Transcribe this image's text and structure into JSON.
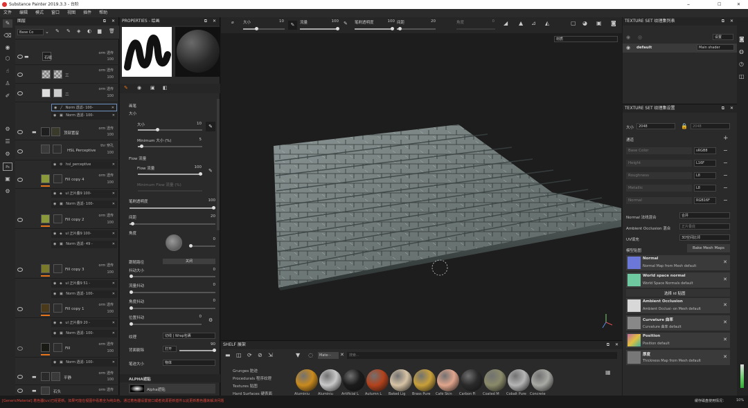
{
  "titlebar": {
    "title": "Substance Painter 2019.3.3 - 台阶",
    "min": "–",
    "max": "☐",
    "close": "✕"
  },
  "menu": [
    "文件",
    "编辑",
    "模式",
    "窗口",
    "视图",
    "插件",
    "帮助"
  ],
  "layers_panel": {
    "title": "图层",
    "blend_mode": "Base Co",
    "layers": [
      {
        "name": "石缝",
        "blend": "orm 透传",
        "opacity": "100"
      },
      {
        "name": "三",
        "blend": "orm 透传",
        "opacity": "100"
      },
      {
        "name": "二",
        "blend": "orm 透传",
        "opacity": "100"
      },
      {
        "name": "顶部置留",
        "blend": "orm 透传",
        "opacity": "100"
      },
      {
        "name": "HSL Perceptive",
        "blend": "thr 穿孔",
        "opacity": "100"
      },
      {
        "name": "Fill copy 4",
        "blend": "orm 透传",
        "opacity": "100"
      },
      {
        "name": "Fill copy 2",
        "blend": "orm 透传",
        "opacity": "100"
      },
      {
        "name": "Fill copy 3",
        "blend": "orm 透传",
        "opacity": "100"
      },
      {
        "name": "Fill copy 1",
        "blend": "orm 透传",
        "opacity": "100"
      },
      {
        "name": "Fill",
        "blend": "orm 透传",
        "opacity": "100"
      },
      {
        "name": "平静",
        "blend": "orm 透传",
        "opacity": "100"
      },
      {
        "name": "石头",
        "blend": "orm 透传",
        "opacity": "100"
      }
    ],
    "subrows": [
      {
        "text": "Norm 透滤- 100-"
      },
      {
        "text": "Norm 透滤- 100-"
      },
      {
        "text": "hsl_perceptive"
      },
      {
        "text": "ul 正片叠9 100-"
      },
      {
        "text": "Norm 透滤- 100-"
      },
      {
        "text": "ul 正片叠9 100-"
      },
      {
        "text": "Norm 透滤- 49 -"
      },
      {
        "text": "ul 正片叠9 51 -"
      },
      {
        "text": "Norm 透滤- 100-"
      },
      {
        "text": "ul 正片叠9 20 -"
      },
      {
        "text": "Norm 透滤- 100-"
      },
      {
        "text": "Norm 透滤- 100-"
      }
    ]
  },
  "properties": {
    "title": "PROPERTIES - 绘画",
    "section": "画笔",
    "size_label": "大小",
    "size_inner": "大小",
    "size_value": "10",
    "minsize_label": "Minimum 大小 (%)",
    "minsize_value": "5",
    "flow_label": "Flow 流量",
    "flow_inner": "Flow 流量",
    "flow_value": "100",
    "minflow_label": "Minimum Flow 流量 (%)",
    "opacity_label": "笔刷透明度",
    "opacity_value": "100",
    "spacing_label": "间距",
    "spacing_value": "20",
    "angle_label": "角度",
    "angle_value": "0",
    "follow_label": "跟随路径",
    "follow_value": "关闭",
    "jitter_size_label": "抖动大小",
    "jitter_size_value": "0",
    "jitter_flow_label": "流量抖动",
    "jitter_flow_value": "0",
    "jitter_angle_label": "角度抖动",
    "jitter_angle_value": "0",
    "jitter_pos_label": "位置抖动",
    "jitter_pos_value": "0",
    "shape_label": "纹理",
    "shape_value": "切线 | Wrap包裹",
    "backface_label": "背面剔除",
    "backface_value": "打开",
    "backface_num": "90",
    "sizespace_label": "笔迹大小",
    "sizespace_value": "物体",
    "alpha_label": "ALPHA遮贴",
    "alpha_item": "Alpha遮贴"
  },
  "toolbar": {
    "size_label": "大小",
    "size_value": "10",
    "flow_label": "流量",
    "flow_value": "100",
    "opacity_label": "笔刷透明度",
    "opacity_value": "100",
    "spacing_label": "间距",
    "spacing_value": "20",
    "angle_label": "角度",
    "angle_value": "0",
    "material_dropdown": "材质"
  },
  "shelf": {
    "title": "SHELF 展架",
    "filter_tag": "Mate···",
    "search_placeholder": "搜索...",
    "categories": [
      "Grunges 脏迹",
      "Procedurals 程序纹理",
      "Textures 贴图",
      "Hard Surfaces 硬表面"
    ],
    "materials": [
      {
        "name": "Aluminiu",
        "color": "#c98a1e"
      },
      {
        "name": "Aluminiu",
        "color": "#c9c9c9"
      },
      {
        "name": "Artificial L",
        "color": "#1b1b1b"
      },
      {
        "name": "Autumn L",
        "color": "#b3421c"
      },
      {
        "name": "Baked Lig",
        "color": "#d7c3a5"
      },
      {
        "name": "Brass Pure",
        "color": "#c8a03a"
      },
      {
        "name": "Café Skin",
        "color": "#e0a58c"
      },
      {
        "name": "Carbon Fi",
        "color": "#2a2a2a"
      },
      {
        "name": "Coated M",
        "color": "#8a8a6a"
      },
      {
        "name": "Cobalt Pure",
        "color": "#b5b5b5"
      },
      {
        "name": "Concrete",
        "color": "#a8a8a4"
      }
    ]
  },
  "texture_list": {
    "title": "TEXTURE SET 纹理集列表",
    "settings_btn": "设置",
    "item": "default",
    "shader": "Main shader"
  },
  "texture_settings": {
    "title": "TEXTURE SET 纹理集设置",
    "size_label": "大小",
    "size_value": "2048",
    "size_field": "2048",
    "channels_label": "通道",
    "channels": [
      {
        "name": "Base Color",
        "format": "sRGB8"
      },
      {
        "name": "Height",
        "format": "L16F"
      },
      {
        "name": "Roughness",
        "format": "L8"
      },
      {
        "name": "Metallic",
        "format": "L8"
      },
      {
        "name": "Normal",
        "format": "RGB16F"
      }
    ],
    "normal_mix_label": "Normal 法线混合",
    "normal_mix_value": "合并",
    "ao_mix_label": "Ambient Occlusion 混合",
    "ao_mix_value": "正片叠底",
    "uv_label": "UV填充",
    "uv_value": "3D空间比邻",
    "model_maps_label": "模型贴图",
    "bake_btn": "Bake Mesh Maps",
    "maps": [
      {
        "title": "Normal",
        "sub": "Normal Map from Mesh default",
        "color": "#6c78d8"
      },
      {
        "title": "World space normal",
        "sub": "World Space Normals default",
        "color": "#6ec8a0"
      },
      {
        "title": "Ambient Occlusion",
        "sub": "Ambient Occlusi··on Mesh default",
        "color": "#d8d8d8"
      },
      {
        "title": "Curvature 曲率",
        "sub": "Curvature 曲率 default",
        "color": "#888888"
      },
      {
        "title": "Position",
        "sub": "Position default",
        "color": "#c06aa0"
      },
      {
        "title": "厚度",
        "sub": "Thickness Map from Mesh default",
        "color": "#777777"
      }
    ],
    "select_id": "选择 id 贴图"
  },
  "status": {
    "message": "[GenericMaterial] 着色器(uv)已经更新。如果可能在视图中看着全为纯白色。通过着色器设置窗口或者资源更新插件以此更新着色器来解决问题",
    "cache_label": "缓存磁盘使用情况：",
    "cache_value": "10%"
  },
  "colors": {
    "accent": "#e8751a",
    "viewport_bg": "#1d1d1d",
    "panel_bg": "#2a2a2a"
  }
}
